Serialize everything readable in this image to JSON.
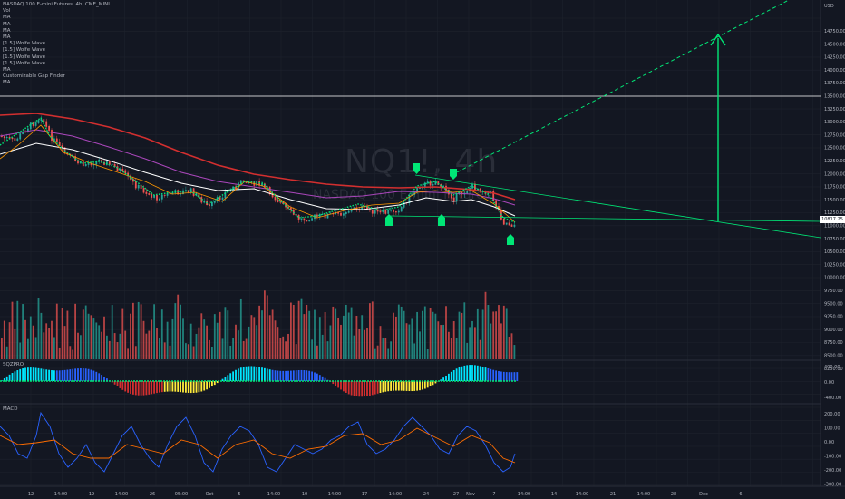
{
  "header": {
    "symbol_line": "NASDAQ 100 E-mini Futures, 4h, CME_MINI",
    "indicators": [
      "Vol",
      "MA",
      "MA",
      "MA",
      "MA",
      "[1.5] Wolfe Wave",
      "[1.5] Wolfe Wave",
      "[1.5] Wolfe Wave",
      "[1.5] Wolfe Wave",
      "MA",
      "Customizable Gap Finder",
      "MA"
    ]
  },
  "watermark": {
    "symbol": "NQ1!, 4h",
    "description": "NASDAQ 100 E-mini Futures"
  },
  "price_scale": {
    "currency": "USD",
    "labels": [
      "14750.00",
      "14500.00",
      "14250.00",
      "14000.00",
      "13750.00",
      "13500.00",
      "13250.00",
      "13000.00",
      "12750.00",
      "12500.00",
      "12250.00",
      "12000.00",
      "11750.00",
      "11500.00",
      "11250.00",
      "11000.00",
      "10750.00",
      "10500.00",
      "10250.00",
      "10000.00",
      "9750.00",
      "9500.00",
      "9250.00",
      "9000.00",
      "8750.00",
      "8500.00",
      "8250.00"
    ],
    "current_price": "10817.25"
  },
  "sqz_pane": {
    "title": "SQZPRO",
    "labels": [
      "400.00",
      "0.00",
      "-400.00"
    ]
  },
  "macd_pane": {
    "title": "MACD",
    "labels": [
      "200.00",
      "100.00",
      "0.00",
      "-100.00",
      "-200.00",
      "-300.00"
    ]
  },
  "time_axis": {
    "labels": [
      "12",
      "14:00",
      "19",
      "14:00",
      "26",
      "05:00",
      "Oct",
      "5",
      "14:00",
      "10",
      "14:00",
      "17",
      "14:00",
      "24",
      "27",
      "Nov",
      "7",
      "14:00",
      "14",
      "14:00",
      "21",
      "14:00",
      "28",
      "Dec",
      "6"
    ]
  },
  "colors": {
    "background": "#131722",
    "up": "#26a69a",
    "down": "#ef5350",
    "ma_red": "#d32f2f",
    "ma_white": "#ffffff",
    "ma_purple": "#ab47bc",
    "ma_orange": "#ff9800",
    "wolfe": "#00e676",
    "horizontal_line": "#ffffff"
  }
}
